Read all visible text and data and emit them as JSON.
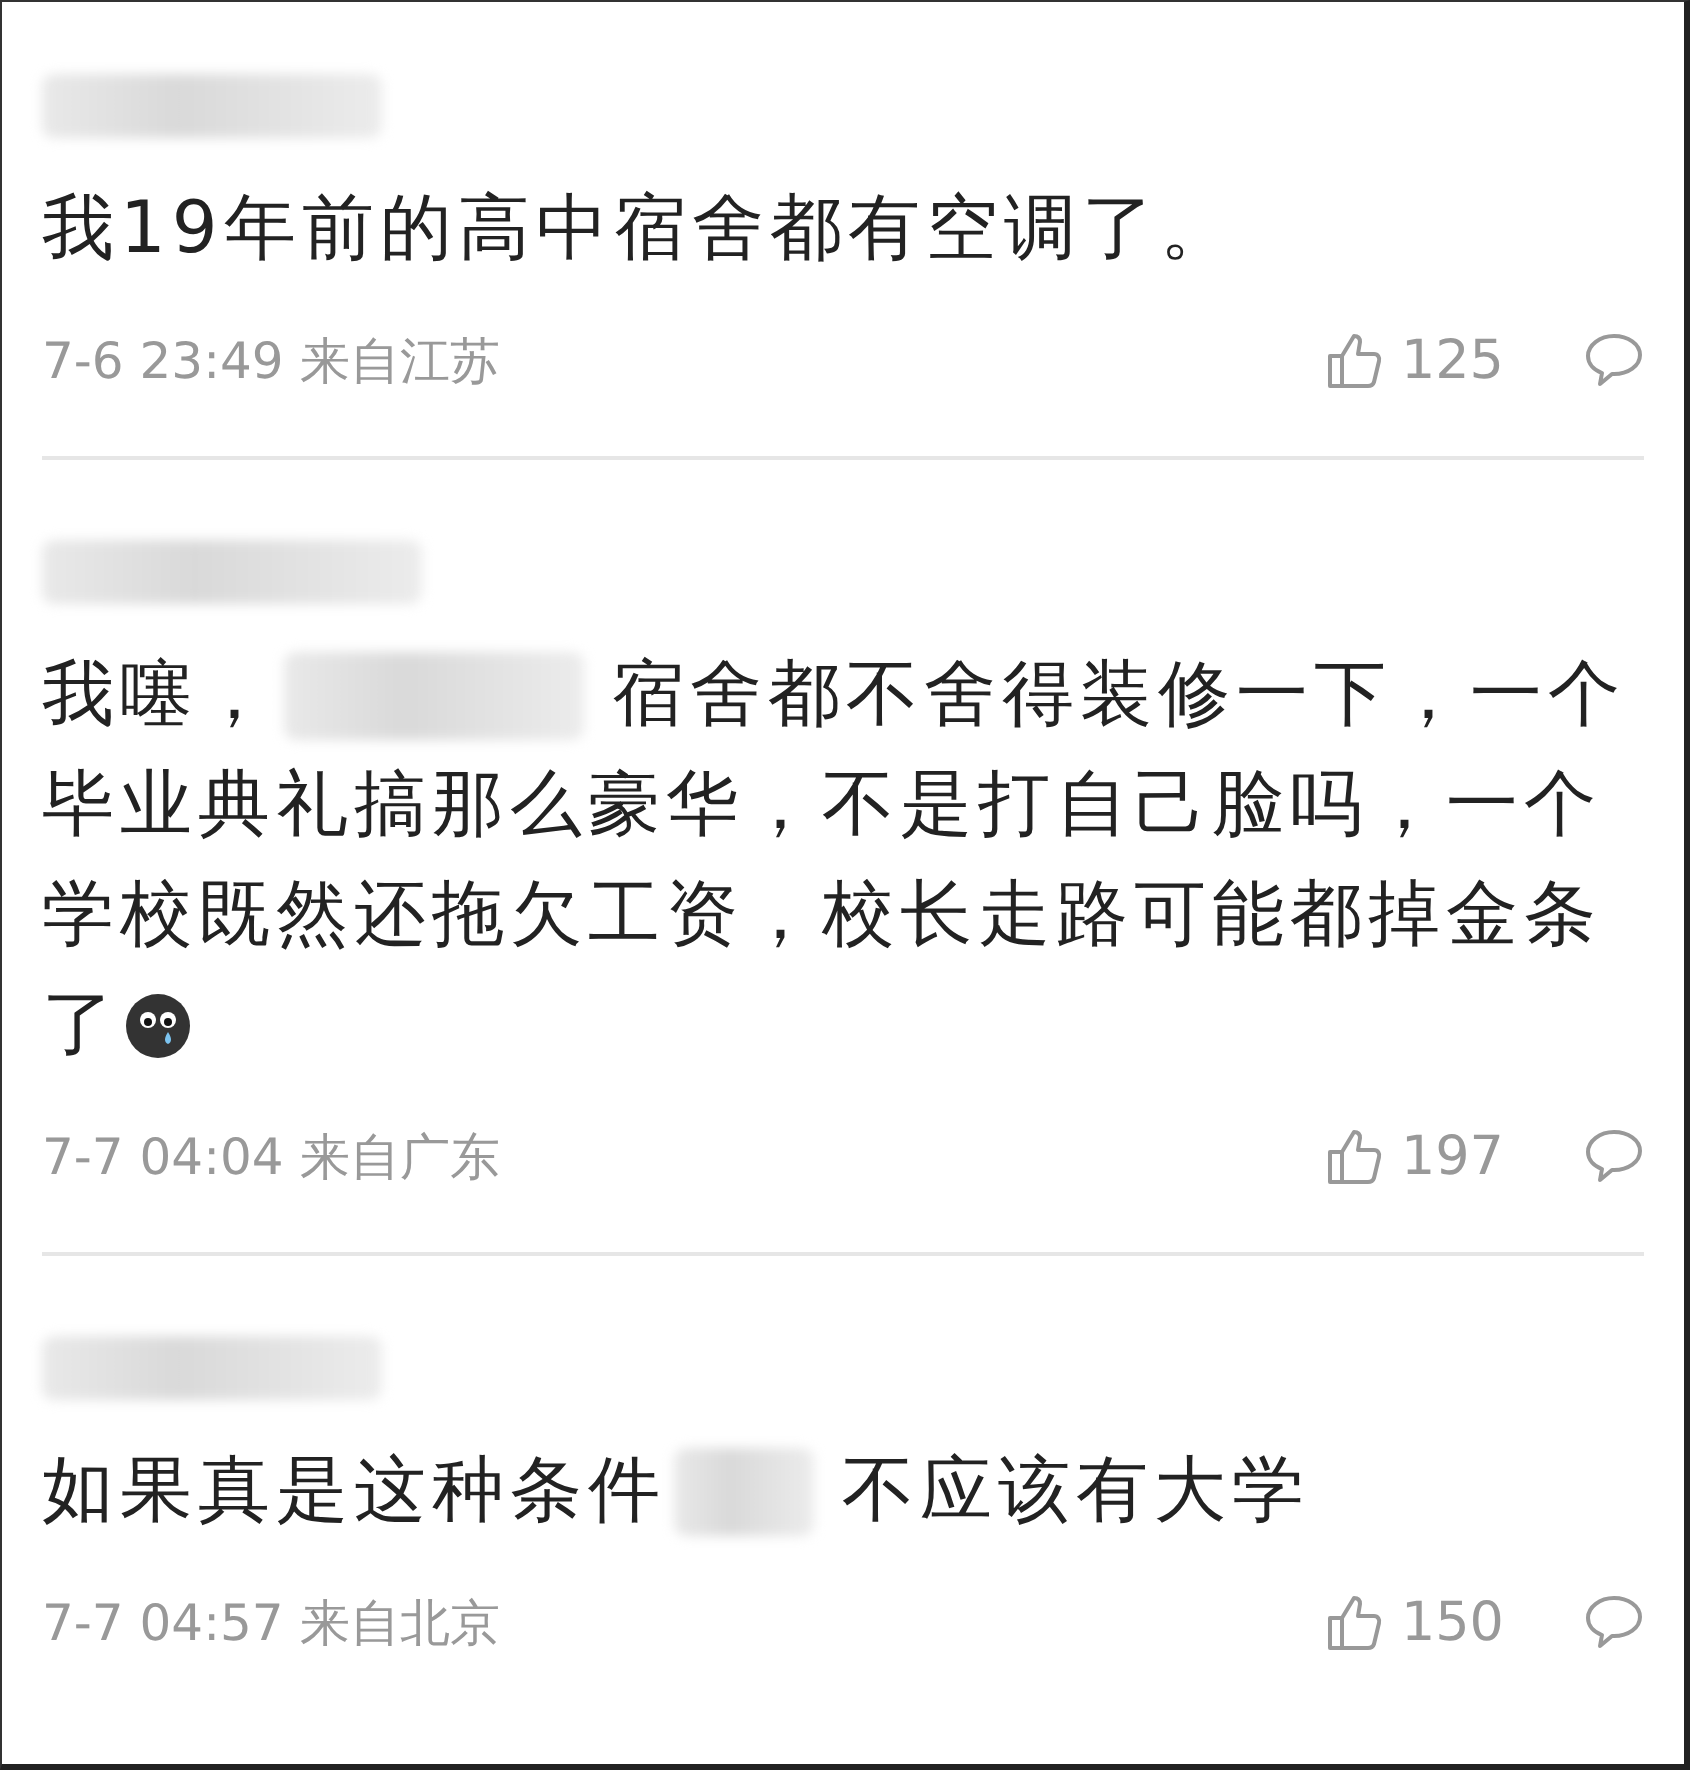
{
  "comments": [
    {
      "author_blurred": true,
      "lines": [
        [
          {
            "kind": "text",
            "text": "我19年前的高中宿舍都有空调了。"
          }
        ]
      ],
      "time": "7-6 23:49 来自江苏",
      "likes": "125"
    },
    {
      "author_blurred": true,
      "lines": [
        [
          {
            "kind": "text",
            "text": "我噻，"
          },
          {
            "kind": "redacted"
          },
          {
            "kind": "text",
            "text": "宿舍都不舍得装修一下，一个"
          }
        ],
        [
          {
            "kind": "text",
            "text": "毕业典礼搞那么豪华，不是打自己脸吗，一个"
          }
        ],
        [
          {
            "kind": "text",
            "text": "学校既然还拖欠工资，校长走路可能都掉金条"
          }
        ],
        [
          {
            "kind": "text",
            "text": "了"
          },
          {
            "kind": "emoji"
          }
        ]
      ],
      "time": "7-7 04:04 来自广东",
      "likes": "197"
    },
    {
      "author_blurred": true,
      "lines": [
        [
          {
            "kind": "text",
            "text": "如果真是这种条件"
          },
          {
            "kind": "redacted"
          },
          {
            "kind": "text",
            "text": "不应该有大学"
          }
        ]
      ],
      "time": "7-7 04:57 来自北京",
      "likes": "150"
    }
  ]
}
